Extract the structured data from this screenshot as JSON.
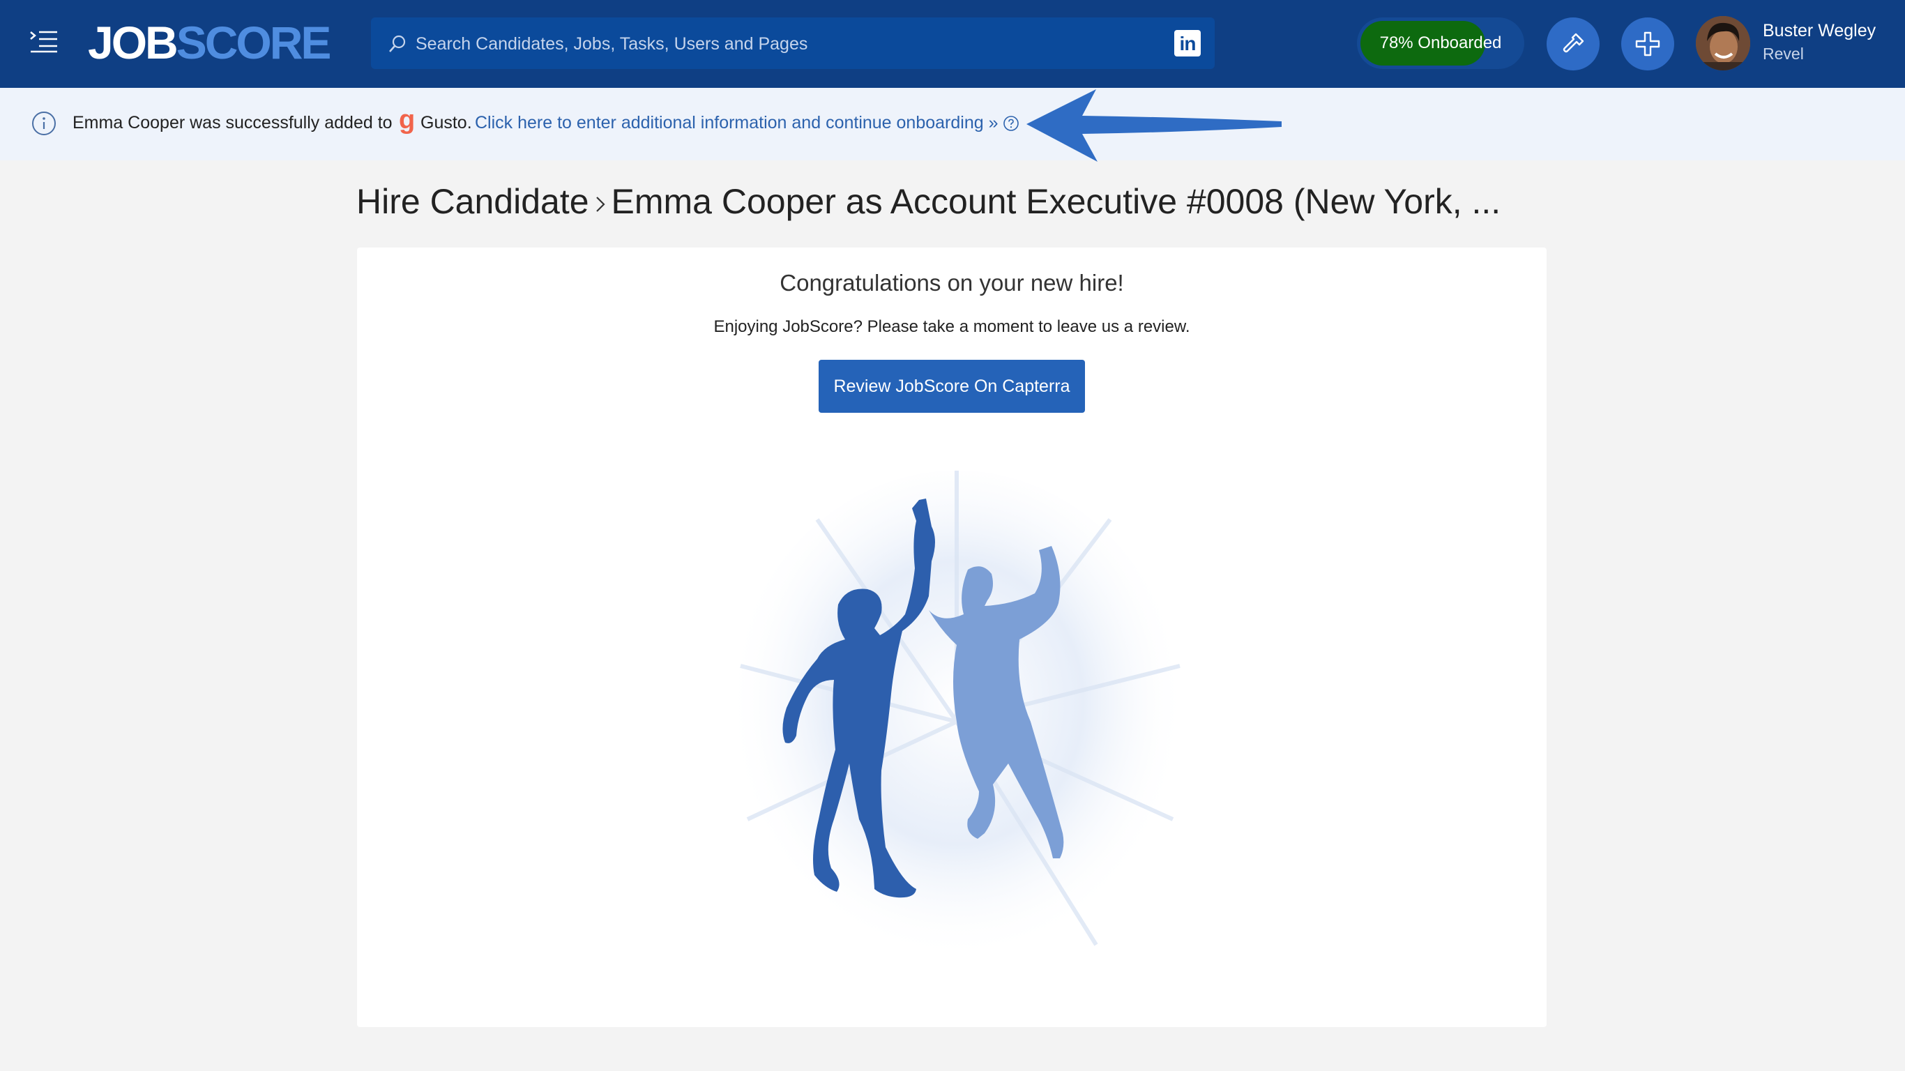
{
  "header": {
    "logo": {
      "part1": "JOB",
      "part2": "SCORE"
    },
    "search": {
      "placeholder": "Search Candidates, Jobs, Tasks, Users and Pages",
      "value": ""
    },
    "linkedin_label": "in",
    "onboarding": {
      "label": "78% Onboarded",
      "progress": 0.78
    },
    "user": {
      "name": "Buster Wegley",
      "org": "Revel"
    }
  },
  "banner": {
    "message": "Emma Cooper was successfully added to",
    "integration_logo": "g",
    "integration_name": "Gusto.",
    "link_text": "Click here to enter additional information and continue onboarding »"
  },
  "page": {
    "breadcrumb_root": "Hire Candidate",
    "title": "Emma Cooper as Account Executive #0008 (New York, ..."
  },
  "card": {
    "heading": "Congratulations on your new hire!",
    "review_prompt": "Enjoying JobScore? Please take a moment to leave us a review.",
    "review_button": "Review JobScore On Capterra"
  },
  "colors": {
    "nav_bg": "#0f3f84",
    "accent": "#2563b8",
    "onboard_fill": "#0d6a0f",
    "banner_bg": "#eef3fb",
    "link": "#2c62ad"
  },
  "icons": [
    "menu-icon",
    "search-icon",
    "linkedin-icon",
    "settings-wrench-icon",
    "plus-icon",
    "info-icon",
    "help-icon",
    "chevron-right-icon",
    "arrow-pointer-icon"
  ]
}
